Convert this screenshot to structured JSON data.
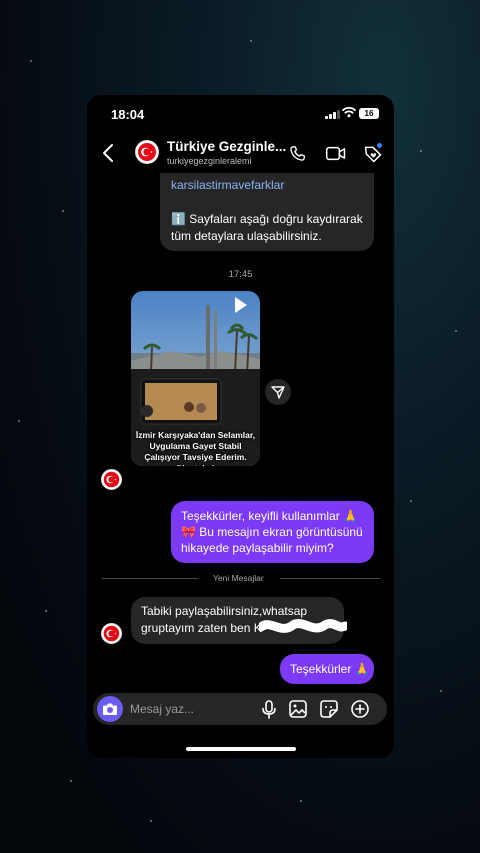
{
  "status_bar": {
    "time": "18:04",
    "battery": "16"
  },
  "header": {
    "title": "Türkiye Gezginle...",
    "username": "turkiyegezginleralemi",
    "back_icon": "chevron-left-icon",
    "call_icon": "phone-icon",
    "video_icon": "video-camera-icon",
    "tag_icon": "tag-icon"
  },
  "messages": {
    "top_link": "karsilastirmavefarklar",
    "top_info": "ℹ️ Sayfaları aşağı doğru kaydırarak tüm detaylara ulaşabilirsiniz.",
    "timestamp": "17:45",
    "video_caption": "İzmir Karşıyaka'dan Selamlar, Uygulama Gayet Stabil Çalışıyor Tavsiye Ederim. (Youtube)",
    "outgoing_1": "Teşekkürler, keyifli kullanımlar 🙏 🎀 Bu mesajın ekran görüntüsünü hikayede paylaşabilir miyim?",
    "separator": "Yeni Mesajlar",
    "incoming_2": "Tabiki paylaşabilirsiniz,whatsap gruptayım zaten ben K",
    "outgoing_2": "Teşekkürler 🙏"
  },
  "input": {
    "placeholder": "Mesaj yaz..."
  },
  "colors": {
    "accent": "#7c3af6",
    "incoming_bubble": "#262626",
    "link": "#8ab4f8",
    "camera_button": "#6b5bf5"
  }
}
